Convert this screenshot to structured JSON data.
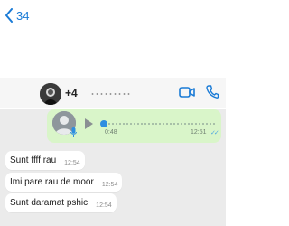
{
  "header": {
    "back_count": "34",
    "contact_name": "+4"
  },
  "voice_message": {
    "duration": "0:48",
    "time": "12:51",
    "ticks": "✓✓",
    "played": 0
  },
  "messages": [
    {
      "text": "Sunt ffff rau",
      "time": "12:54"
    },
    {
      "text": "Imi pare rau de moor",
      "time": "12:54"
    },
    {
      "text": "Sunt daramat pshic",
      "time": "12:54"
    }
  ],
  "colors": {
    "accent": "#1a7bd6",
    "outgoing_bubble": "#d9f5c9",
    "incoming_bubble": "#ffffff",
    "chat_background": "#ebebeb",
    "read_ticks": "#4fa8e0"
  }
}
